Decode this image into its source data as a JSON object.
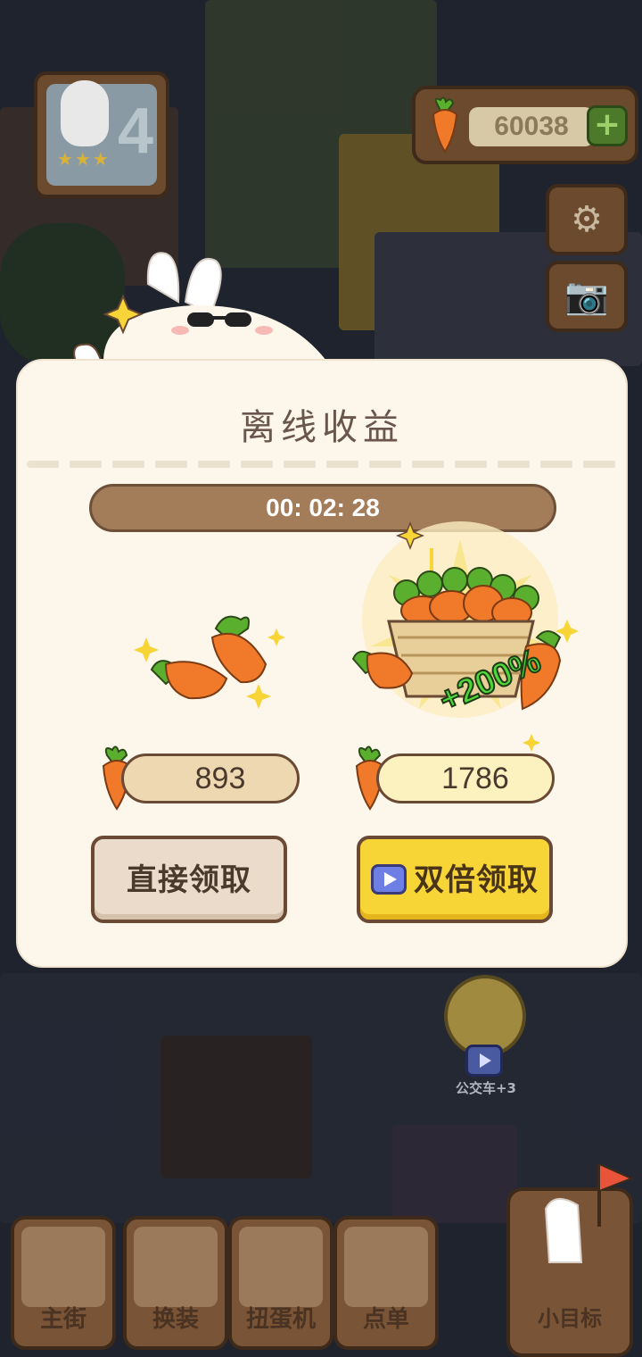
{
  "hud": {
    "level": "4",
    "level_stars": "★★★",
    "carrot_count": "60038",
    "add_symbol": "+"
  },
  "dialog": {
    "title": "离线收益",
    "timer": "00: 02: 28",
    "normal_amount": "893",
    "double_amount": "1786",
    "bonus_label": "+200%",
    "claim_button": "直接领取",
    "double_button": "双倍领取"
  },
  "bus": {
    "label": "公交车+3"
  },
  "bottom_nav": {
    "items": [
      {
        "label": "主街"
      },
      {
        "label": "换装"
      },
      {
        "label": "扭蛋机"
      },
      {
        "label": "点单"
      }
    ],
    "goal_label": "小目标"
  },
  "colors": {
    "dialog_bg": "#fdf6ea",
    "timer_bar": "#a37c5a",
    "double_button": "#f7d537",
    "bonus_text": "#4fd83c",
    "carrot": "#f07a2a"
  }
}
